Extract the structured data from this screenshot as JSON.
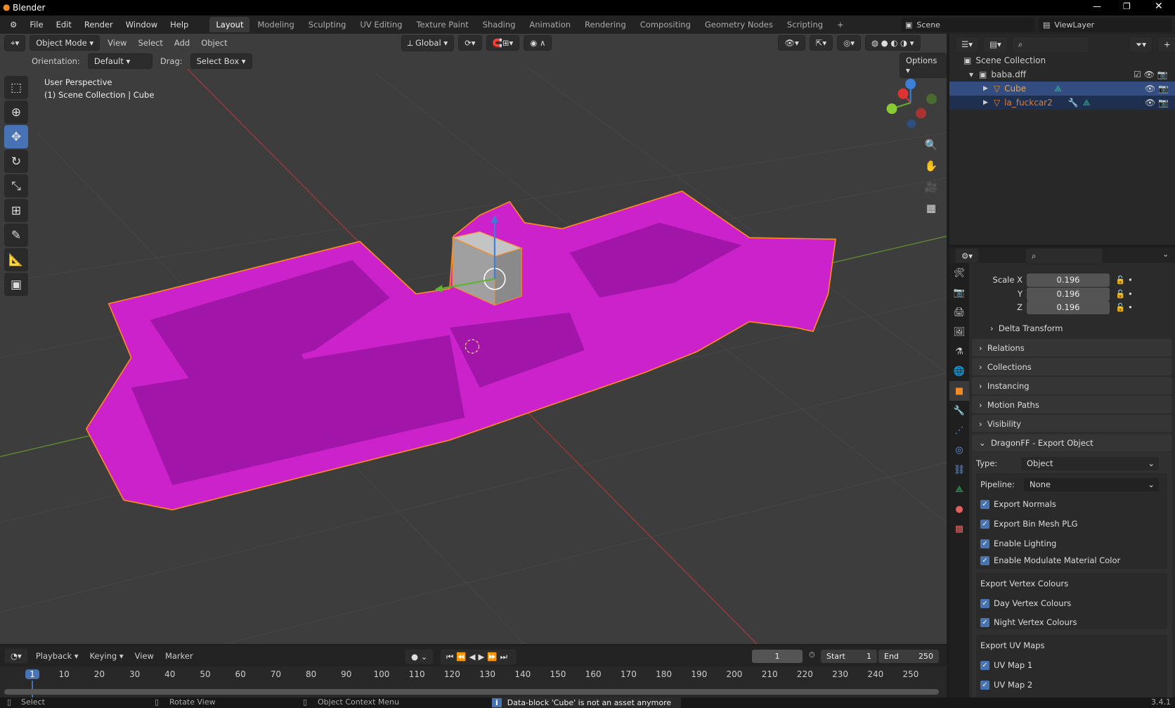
{
  "app": {
    "title": "Blender",
    "version": "3.4.1"
  },
  "menu": [
    "File",
    "Edit",
    "Render",
    "Window",
    "Help"
  ],
  "workspaces": [
    "Layout",
    "Modeling",
    "Sculpting",
    "UV Editing",
    "Texture Paint",
    "Shading",
    "Animation",
    "Rendering",
    "Compositing",
    "Geometry Nodes",
    "Scripting"
  ],
  "active_workspace": "Layout",
  "scene": {
    "name": "Scene",
    "view_layer": "ViewLayer"
  },
  "viewport": {
    "mode": "Object Mode",
    "menus": [
      "View",
      "Select",
      "Add",
      "Object"
    ],
    "transform_orientation": "Global",
    "orientation_label": "Orientation:",
    "orientation_value": "Default",
    "drag_label": "Drag:",
    "drag_value": "Select Box",
    "options": "Options",
    "overlay_title": "User Perspective",
    "overlay_subtitle": "(1) Scene Collection | Cube",
    "object_color": "#cc22cc",
    "selection_color": "#ff8c1a"
  },
  "outliner": {
    "root": "Scene Collection",
    "collection": "baba.dff",
    "items": [
      {
        "name": "Cube",
        "selected": true
      },
      {
        "name": "la_fuckcar2",
        "selected": false
      }
    ]
  },
  "properties": {
    "scale": {
      "x_label": "Scale X",
      "y_label": "Y",
      "z_label": "Z",
      "x": "0.196",
      "y": "0.196",
      "z": "0.196"
    },
    "delta_transform": "Delta Transform",
    "panels": [
      "Relations",
      "Collections",
      "Instancing",
      "Motion Paths",
      "Visibility"
    ],
    "dragonff": {
      "title": "DragonFF - Export Object",
      "type_label": "Type:",
      "type_value": "Object",
      "pipeline_label": "Pipeline:",
      "pipeline_value": "None",
      "checks": [
        {
          "label": "Export Normals",
          "checked": true
        },
        {
          "label": "Export Bin Mesh PLG",
          "checked": true
        },
        {
          "label": "Enable Lighting",
          "checked": true
        },
        {
          "label": "Enable Modulate Material Color",
          "checked": true
        }
      ],
      "vertex_title": "Export Vertex Colours",
      "vertex": [
        {
          "label": "Day Vertex Colours",
          "checked": true
        },
        {
          "label": "Night Vertex Colours",
          "checked": true
        }
      ],
      "uv_title": "Export UV Maps",
      "uv": [
        {
          "label": "UV Map 1",
          "checked": true
        },
        {
          "label": "UV Map 2",
          "checked": true
        }
      ]
    }
  },
  "timeline": {
    "menus": [
      "Playback",
      "Keying",
      "View",
      "Marker"
    ],
    "current_frame": "1",
    "start_label": "Start",
    "start": "1",
    "end_label": "End",
    "end": "250",
    "ticks": [
      "1",
      "10",
      "20",
      "30",
      "40",
      "50",
      "60",
      "70",
      "80",
      "90",
      "100",
      "110",
      "120",
      "130",
      "140",
      "150",
      "160",
      "170",
      "180",
      "190",
      "200",
      "210",
      "220",
      "230",
      "240",
      "250"
    ]
  },
  "status": {
    "select": "Select",
    "rotate": "Rotate View",
    "context": "Object Context Menu",
    "message": "Data-block 'Cube' is not an asset anymore"
  }
}
